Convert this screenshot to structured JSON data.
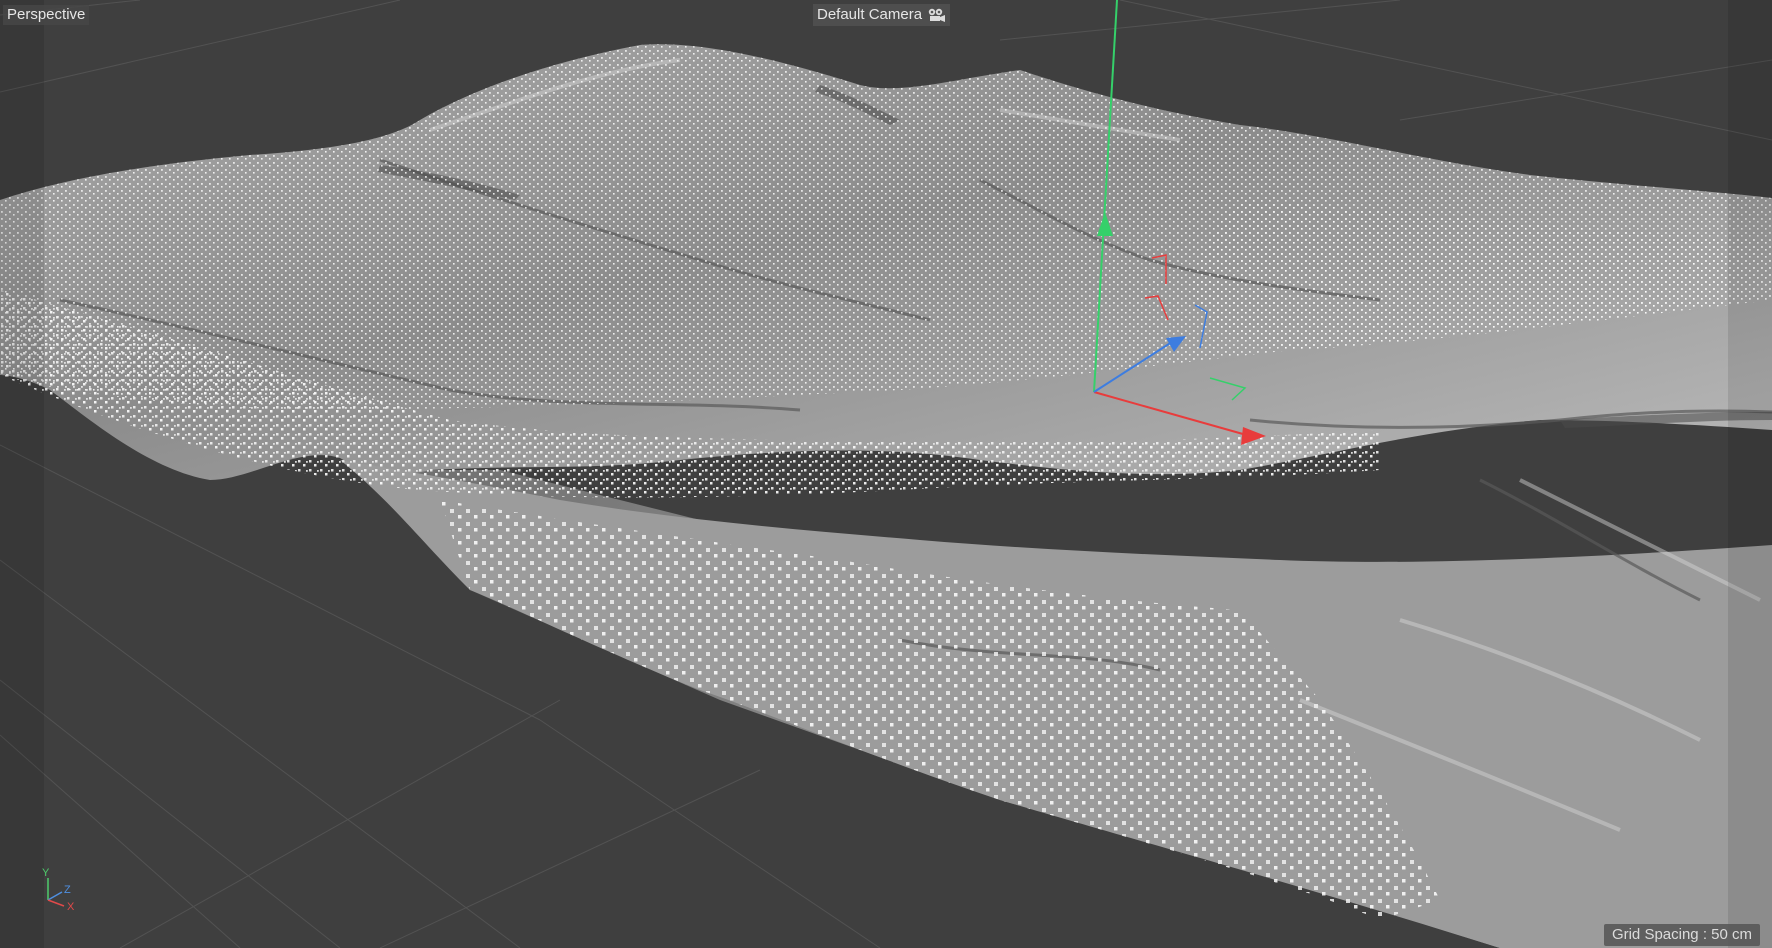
{
  "viewport": {
    "view_mode": "Perspective",
    "camera_name": "Default Camera",
    "grid_spacing": "Grid Spacing : 50 cm"
  },
  "axis_widget": {
    "y_label": "Y",
    "z_label": "Z",
    "x_label": "X",
    "y_color": "#4ecb6b",
    "z_color": "#4f8fe0",
    "x_color": "#e04a4a"
  },
  "gizmo": {
    "y_axis_color": "#35d06a",
    "x_axis_color": "#e83c3c",
    "z_axis_color": "#3d7de0"
  },
  "icons": {
    "camera": "camera-icon"
  },
  "colors": {
    "background": "#3f3f3f",
    "terrain_light": "#c8c8c8",
    "terrain_mid": "#8a8a8a",
    "terrain_dark": "#555555",
    "points": "#ffffff"
  }
}
